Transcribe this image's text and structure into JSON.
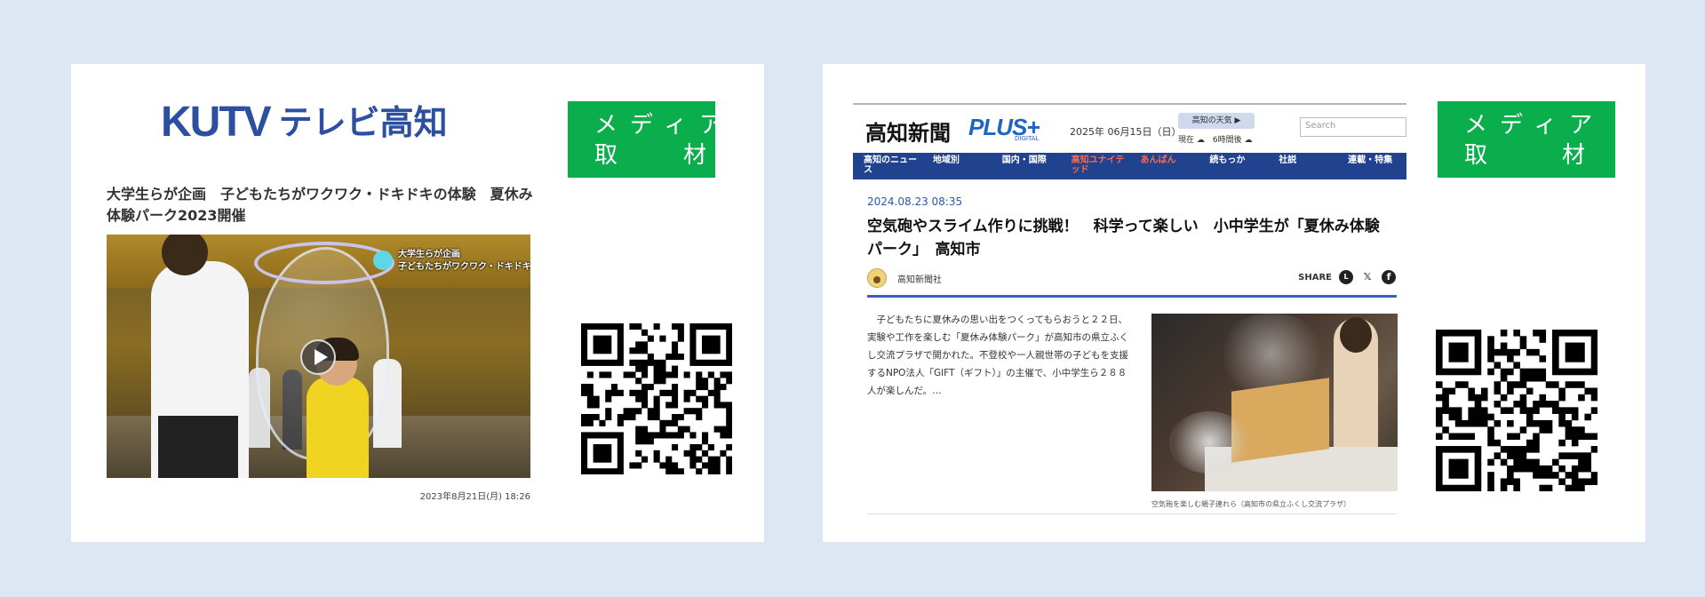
{
  "cards": [
    {
      "badge": {
        "line1": "メディア",
        "line2_left": "取",
        "line2_right": "材",
        "color": "#0bae4d"
      },
      "logo": {
        "mark": "KUTV",
        "name": "テレビ高知",
        "color": "#2d4fa0"
      },
      "title": "大学生らが企画　子どもたちがワクワク・ドキドキの体験　夏休み体験パーク2023開催",
      "video": {
        "overlay_caption_line1": "大学生らが企画",
        "overlay_caption_line2": "子どもたちがワクワク・ドキドキの体験",
        "icon": "play-icon"
      },
      "date": "2023年8月21日(月) 18:26",
      "qr_icon": "qr-code-icon"
    },
    {
      "badge": {
        "line1": "メディア",
        "line2_left": "取",
        "line2_right": "材",
        "color": "#0bae4d"
      },
      "newspaper": {
        "logo": "高知新聞",
        "logo_plus": "PLUS+",
        "logo_digital": "DIGITAL",
        "date": "2025年 06月15日（日）",
        "weather_button": "高知の天気 ▶",
        "weather_now": "現在 ☁　6時間後 ☁",
        "search_placeholder": "Search",
        "nav": [
          "高知のニュース",
          "地域別",
          "国内・国際",
          "高知ユナイテッド",
          "あんぱん",
          "続もっか",
          "社説",
          "連載・特集"
        ],
        "article_date": "2024.08.23 08:35",
        "article_title": "空気砲やスライム作りに挑戦！　科学って楽しい　小中学生が「夏休み体験パーク」　高知市",
        "author": "高知新聞社",
        "share_label": "SHARE",
        "body": "　子どもたちに夏休みの思い出をつくってもらおうと２２日、実験や工作を楽しむ「夏休み体験パーク」が高知市の県立ふくし交流プラザで開かれた。不登校や一人親世帯の子どもを支援するNPO法人「GIFT（ギフト）」の主催で、小中学生ら２８８人が楽しんだ。…",
        "photo_caption": "空気砲を楽しむ親子連れら（高知市の県立ふくし交流プラザ）",
        "accent_color": "#21428f"
      },
      "qr_icon": "qr-code-icon"
    }
  ]
}
